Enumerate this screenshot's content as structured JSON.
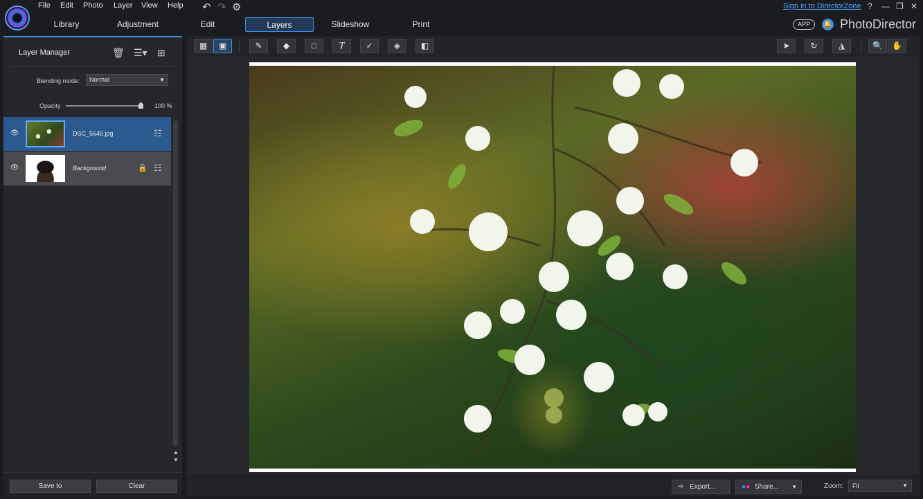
{
  "menu": [
    "File",
    "Edit",
    "Photo",
    "Layer",
    "View",
    "Help"
  ],
  "tabs": [
    "Library",
    "Adjustment",
    "Edit",
    "Layers",
    "Slideshow",
    "Print"
  ],
  "active_tab": "Layers",
  "header": {
    "signin": "Sign in to DirectorZone",
    "help": "?",
    "app_badge": "APP",
    "brand": "PhotoDirector"
  },
  "layer_manager": {
    "title": "Layer Manager",
    "blending_label": "Blending mode:",
    "blending_value": "Normal",
    "opacity_label": "Opacity",
    "opacity_value": "100 %",
    "opacity_fraction": 1.0,
    "layers": [
      {
        "name": "DSC_5645.jpg",
        "selected": true,
        "locked": false
      },
      {
        "name": "Background",
        "selected": false,
        "locked": true
      }
    ],
    "save_button": "Save to",
    "clear_button": "Clear"
  },
  "bottom": {
    "export": "Export...",
    "share": "Share...",
    "zoom_label": "Zoom:",
    "zoom_value": "Fit"
  },
  "colors": {
    "accent": "#3f8ee0",
    "selected_row": "#2d5a8e",
    "link": "#4ea3ff"
  }
}
